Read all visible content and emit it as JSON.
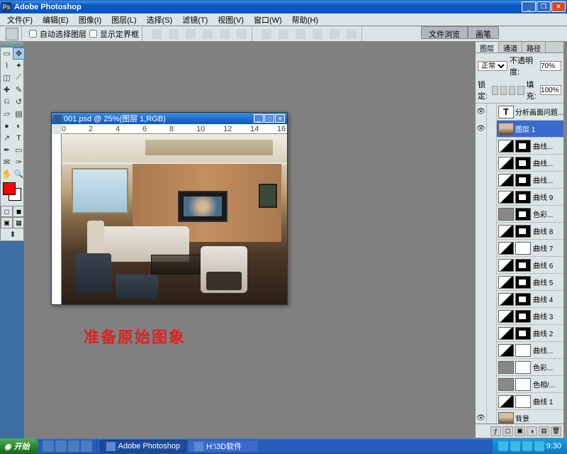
{
  "title": "Adobe Photoshop",
  "menu": [
    "文件(F)",
    "编辑(E)",
    "图像(I)",
    "图层(L)",
    "选择(S)",
    "滤镜(T)",
    "视图(V)",
    "窗口(W)",
    "帮助(H)"
  ],
  "options": {
    "auto_select": "自动选择图层",
    "show_bounds": "显示定界框"
  },
  "dock_tabs": [
    "文件浏览",
    "画笔"
  ],
  "doc": {
    "title": "001.psd @ 25%(图层 1,RGB)",
    "ruler": [
      "0",
      "2",
      "4",
      "6",
      "8",
      "10",
      "12",
      "14",
      "16"
    ]
  },
  "caption": "准备原始图象",
  "layers_panel": {
    "tabs": [
      "图层",
      "通道",
      "路径"
    ],
    "blend": "正常",
    "opacity_label": "不透明度:",
    "opacity": "70%",
    "lock_label": "锁定:",
    "fill_label": "填充:",
    "fill": "100%",
    "layers": [
      {
        "eye": true,
        "thumb": "txt",
        "name": "分析画面问题...",
        "sel": false
      },
      {
        "eye": true,
        "thumb": "room",
        "name": "图层 1",
        "sel": true
      },
      {
        "eye": false,
        "thumb": "curves",
        "mask": "b",
        "name": "曲线..."
      },
      {
        "eye": false,
        "thumb": "curves",
        "mask": "b",
        "name": "曲线..."
      },
      {
        "eye": false,
        "thumb": "curves",
        "mask": "b",
        "name": "曲线..."
      },
      {
        "eye": false,
        "thumb": "curves",
        "mask": "b",
        "name": "曲线 9"
      },
      {
        "eye": false,
        "thumb": "solid",
        "mask": "b",
        "name": "色彩..."
      },
      {
        "eye": false,
        "thumb": "curves",
        "mask": "b",
        "name": "曲线 8"
      },
      {
        "eye": false,
        "thumb": "curves",
        "mask": "w",
        "name": "曲线 7"
      },
      {
        "eye": false,
        "thumb": "curves",
        "mask": "b",
        "name": "曲线 6"
      },
      {
        "eye": false,
        "thumb": "curves",
        "mask": "b",
        "name": "曲线 5"
      },
      {
        "eye": false,
        "thumb": "curves",
        "mask": "b",
        "name": "曲线 4"
      },
      {
        "eye": false,
        "thumb": "curves",
        "mask": "b",
        "name": "曲线 3"
      },
      {
        "eye": false,
        "thumb": "curves",
        "mask": "b",
        "name": "曲线 2"
      },
      {
        "eye": false,
        "thumb": "curves",
        "mask": "w",
        "name": "曲线..."
      },
      {
        "eye": false,
        "thumb": "solid",
        "mask": "w",
        "name": "色彩..."
      },
      {
        "eye": false,
        "thumb": "solid",
        "mask": "w",
        "name": "色相/..."
      },
      {
        "eye": false,
        "thumb": "curves",
        "mask": "w",
        "name": "曲线 1"
      },
      {
        "eye": true,
        "thumb": "room",
        "name": "背景"
      }
    ]
  },
  "taskbar": {
    "start": "开始",
    "tasks": [
      {
        "label": "Adobe Photoshop",
        "act": true
      },
      {
        "label": "H:\\3D软件",
        "act": false
      }
    ],
    "time": "9:30"
  }
}
